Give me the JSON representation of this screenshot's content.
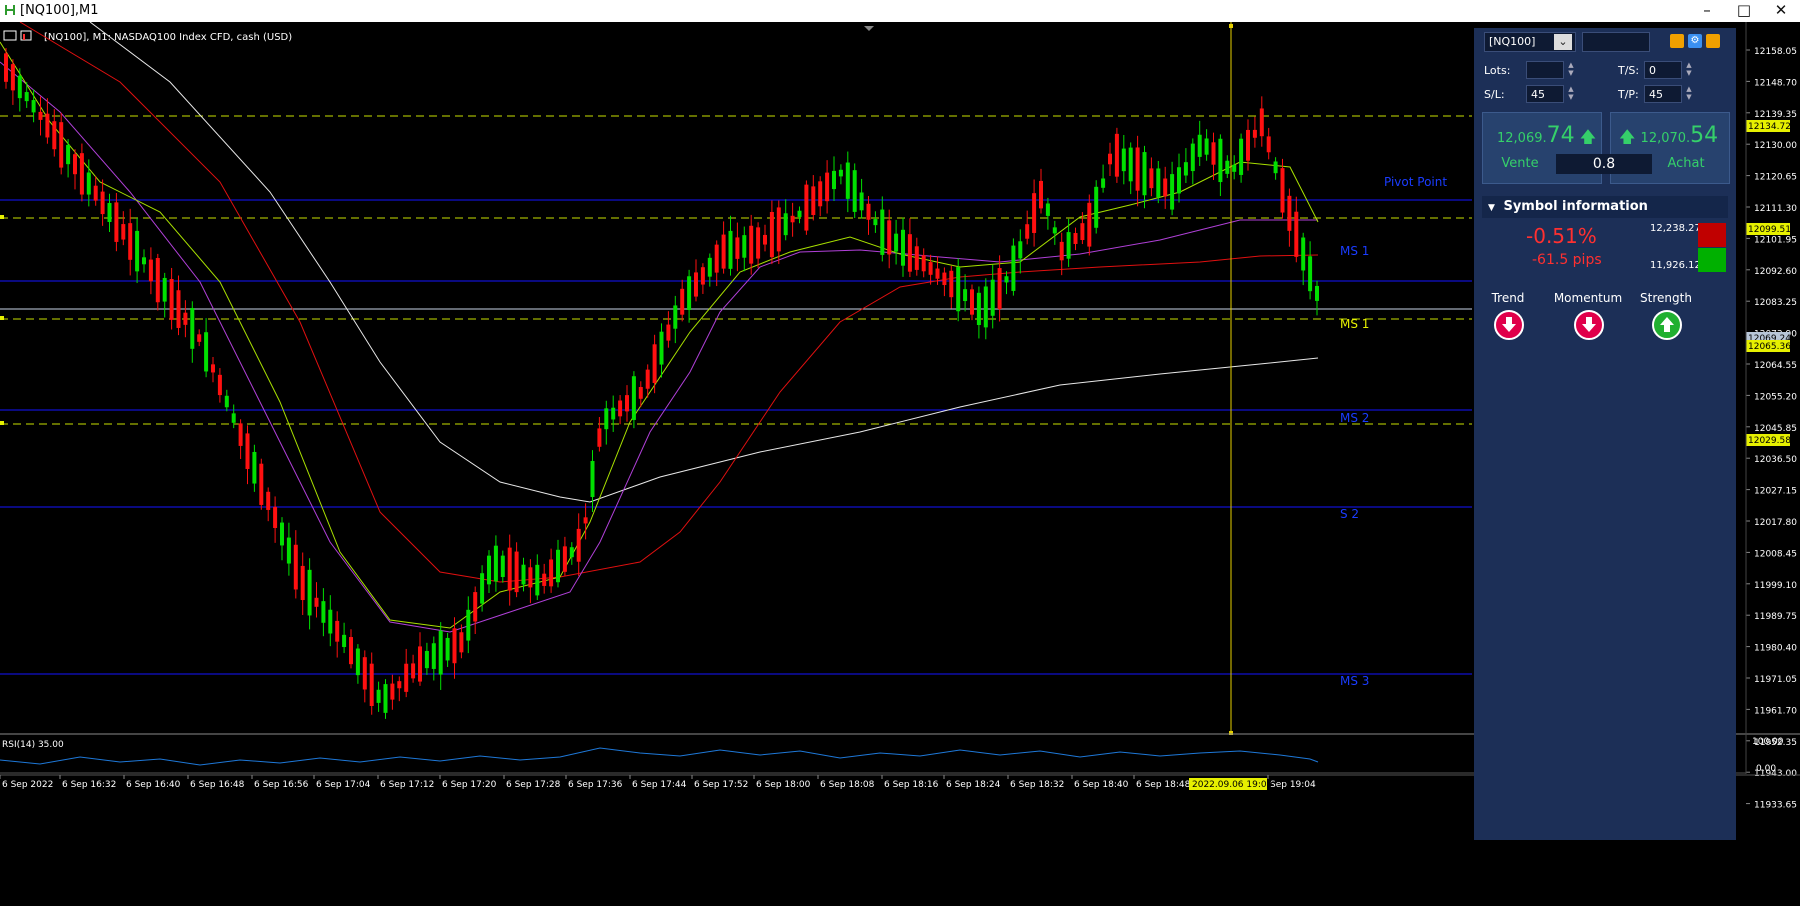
{
  "window": {
    "title": "[NQ100],M1",
    "chart_info": "[NQ100], M1:  NASDAQ100 Index CFD, cash (USD)"
  },
  "price_axis": {
    "labels": [
      "12158.05",
      "12148.70",
      "12139.35",
      "12130.00",
      "12120.65",
      "12111.30",
      "12101.95",
      "12092.60",
      "12083.25",
      "12073.90",
      "12064.55",
      "12055.20",
      "12045.85",
      "12036.50",
      "12027.15",
      "12017.80",
      "12008.45",
      "11999.10",
      "11989.75",
      "11980.40",
      "11971.05",
      "11961.70",
      "11952.35",
      "11943.00",
      "11933.65"
    ],
    "tags": [
      {
        "text": "12134.72",
        "color": "#e6f000"
      },
      {
        "text": "12099.51",
        "color": "#e6f000"
      },
      {
        "text": "12069.24",
        "color": "#b8c6d8"
      },
      {
        "text": "12065.36",
        "color": "#e6f000"
      },
      {
        "text": "12029.58",
        "color": "#e6f000"
      }
    ]
  },
  "pivot_labels": [
    {
      "text": "Pivot Point",
      "color": "#1a3cff"
    },
    {
      "text": "MS 1",
      "color": "#1a3cff"
    },
    {
      "text": "MS 1",
      "color": "#e6f000"
    },
    {
      "text": "MS 2",
      "color": "#1a3cff"
    },
    {
      "text": "S 2",
      "color": "#1a3cff"
    },
    {
      "text": "MS 3",
      "color": "#1a3cff"
    }
  ],
  "time_axis": {
    "labels": [
      "6 Sep 2022",
      "6 Sep 16:32",
      "6 Sep 16:40",
      "6 Sep 16:48",
      "6 Sep 16:56",
      "6 Sep 17:04",
      "6 Sep 17:12",
      "6 Sep 17:20",
      "6 Sep 17:28",
      "6 Sep 17:36",
      "6 Sep 17:44",
      "6 Sep 17:52",
      "6 Sep 18:00",
      "6 Sep 18:08",
      "6 Sep 18:16",
      "6 Sep 18:24",
      "6 Sep 18:32",
      "6 Sep 18:40",
      "6 Sep 18:48",
      "Sep 19:04"
    ],
    "cursor_label": "2022.09.06 19:00"
  },
  "rsi": {
    "label": "RSI(14) 35.00",
    "max_label": "100.00",
    "min_label": "0.00"
  },
  "trade_panel": {
    "symbol": "[NQ100]",
    "lots_label": "Lots:",
    "lots_value": "",
    "ts_label": "T/S:",
    "ts_value": "0",
    "sl_label": "S/L:",
    "sl_value": "45",
    "tp_label": "T/P:",
    "tp_value": "45",
    "sell_price_small": "12,069.",
    "sell_price_big": "74",
    "buy_price_small": "12,070.",
    "buy_price_big": "54",
    "sell_label": "Vente",
    "buy_label": "Achat",
    "spread": "0.8"
  },
  "symbol_info": {
    "header": "Symbol information",
    "change_pct": "-0.51%",
    "change_pips": "-61.5 pips",
    "high": "12,238.27",
    "low": "11,926.12",
    "high_color": "#c00000",
    "low_color": "#00b000",
    "indicators": [
      {
        "label": "Trend",
        "direction": "down",
        "color": "#e0004a"
      },
      {
        "label": "Momentum",
        "direction": "down",
        "color": "#e0004a"
      },
      {
        "label": "Strength",
        "direction": "up",
        "color": "#20b030"
      }
    ]
  },
  "colors": {
    "up_candle": "#00e000",
    "down_candle": "#ff1010",
    "pivot_line": "#1414ff",
    "dashed_level": "#c8e000",
    "crosshair": "#e6d000"
  }
}
